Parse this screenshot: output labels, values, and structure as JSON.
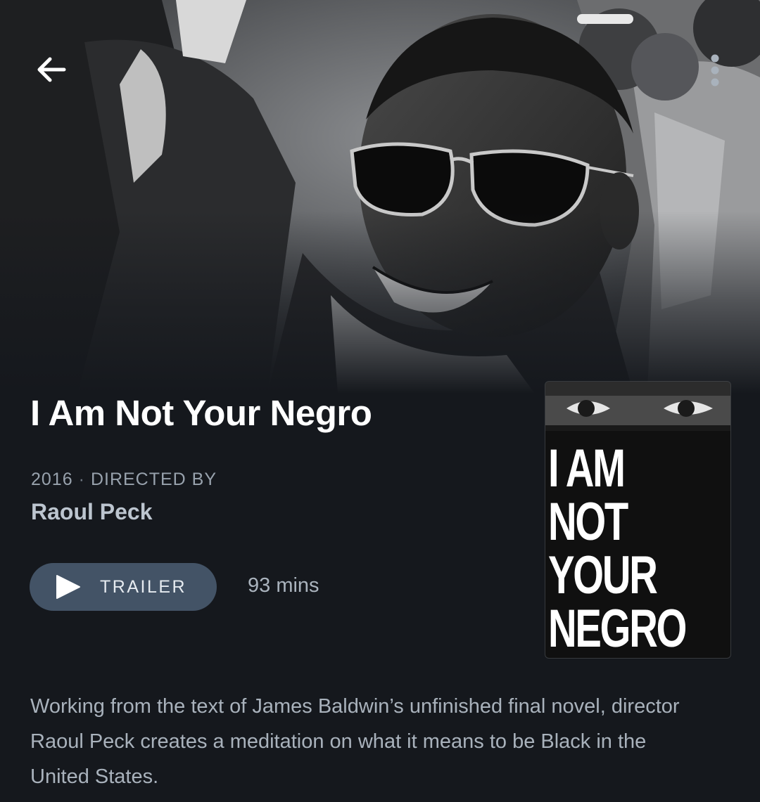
{
  "header": {
    "back_icon": "arrow-left-icon",
    "more_icon": "more-vertical-icon"
  },
  "film": {
    "title": "I Am Not Your Negro",
    "year": "2016",
    "separator": "·",
    "directed_by_label": "DIRECTED BY",
    "director": "Raoul Peck",
    "trailer_label": "TRAILER",
    "trailer_icon": "play-icon",
    "runtime": "93 mins",
    "description": "Working from the text of James Baldwin’s unfinished final novel, director Raoul Peck creates a meditation on what it means to be Black in the United States."
  },
  "poster": {
    "lines": [
      "I AM",
      "NOT",
      "YOUR",
      "NEGRO"
    ]
  },
  "colors": {
    "background": "#15181d",
    "trailer_button": "#435366",
    "title_text": "#ffffff",
    "muted_text": "#98a2ad",
    "director_text": "#bcc5cf"
  }
}
